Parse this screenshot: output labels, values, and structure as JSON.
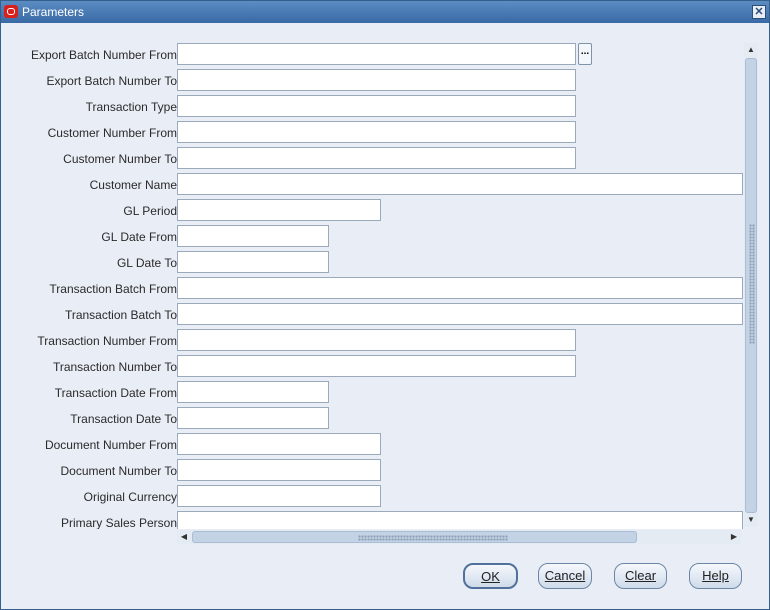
{
  "window": {
    "title": "Parameters"
  },
  "fields": [
    {
      "label": "Export Batch Number From",
      "value": ""
    },
    {
      "label": "Export Batch Number To",
      "value": ""
    },
    {
      "label": "Transaction Type",
      "value": ""
    },
    {
      "label": "Customer Number From",
      "value": ""
    },
    {
      "label": "Customer Number To",
      "value": ""
    },
    {
      "label": "Customer Name",
      "value": ""
    },
    {
      "label": "GL Period",
      "value": ""
    },
    {
      "label": "GL Date From",
      "value": ""
    },
    {
      "label": "GL Date To",
      "value": ""
    },
    {
      "label": "Transaction Batch From",
      "value": ""
    },
    {
      "label": "Transaction Batch To",
      "value": ""
    },
    {
      "label": "Transaction Number From",
      "value": ""
    },
    {
      "label": "Transaction Number To",
      "value": ""
    },
    {
      "label": "Transaction Date From",
      "value": ""
    },
    {
      "label": "Transaction Date To",
      "value": ""
    },
    {
      "label": "Document Number From",
      "value": ""
    },
    {
      "label": "Document Number To",
      "value": ""
    },
    {
      "label": "Original Currency",
      "value": ""
    },
    {
      "label": "Primary Sales Person",
      "value": ""
    }
  ],
  "lov_button": {
    "label": "..."
  },
  "buttons": {
    "ok": "OK",
    "cancel": "Cancel",
    "clear": "Clear",
    "help": "Help"
  }
}
